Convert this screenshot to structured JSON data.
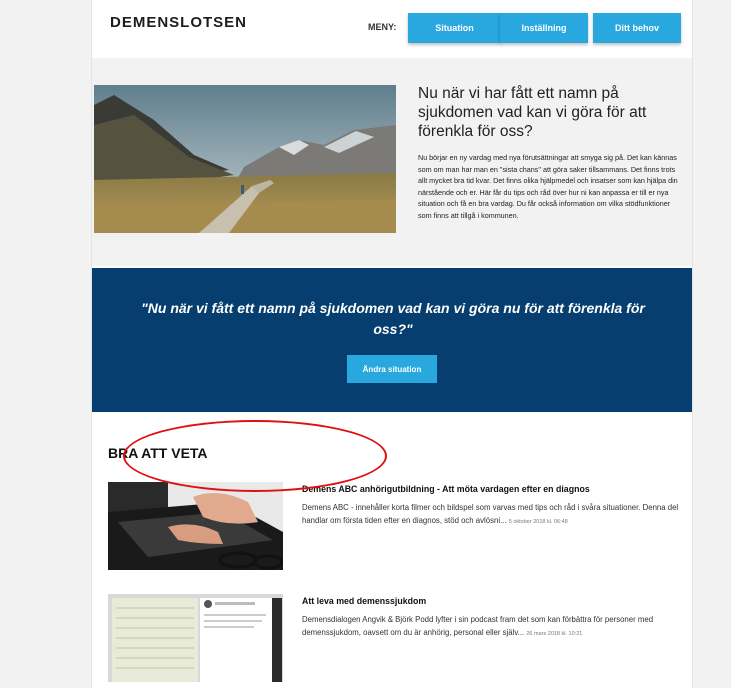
{
  "header": {
    "logo": "DEMENSLOTSEN",
    "menu_label": "MENY:",
    "nav": [
      "Situation",
      "Inställning",
      "Ditt behov"
    ]
  },
  "intro": {
    "title": "Nu när vi har fått ett namn på sjukdomen vad kan vi göra för att förenkla för oss?",
    "text": "Nu börjar en ny vardag med nya förutsättningar att smyga sig på. Det kan kännas som om man har man en \"sista chans\" att göra saker tillsammans. Det finns trots allt mycket bra tid kvar. Det finns olika hjälpmedel och insatser som kan hjälpa din närstående och er. Här får du tips och råd över hur ni kan anpassa er till er nya situation och få en bra vardag. Du får också information om vilka stödfunktioner som finns att tillgå i kommunen."
  },
  "banner": {
    "quote": "\"Nu när vi fått ett namn på sjukdomen vad kan vi göra nu för att förenkla för oss?\"",
    "button": "Ändra situation"
  },
  "section": {
    "title": "BRA ATT VETA"
  },
  "articles": [
    {
      "title": "Demens ABC anhörigutbildning - Att möta vardagen efter en diagnos",
      "text": "Demens ABC - innehåller korta filmer och bildspel som varvas med tips och råd i svåra situationer. Denna del handlar om första tiden efter en diagnos, stöd och avlösni...",
      "date": "5 oktober 2018 kl. 06:48"
    },
    {
      "title": "Att leva med demenssjukdom",
      "text": "Demensdialogen Angvik & Björk Podd lyfter i sin podcast fram det som kan förbättra för personer med demenssjukdom, oavsett om du är anhörig, personal eller själv...",
      "date": "26 mars 2018 kl. 10:21"
    }
  ],
  "colors": {
    "accent": "#29a7df",
    "banner": "#053e6f",
    "annotation": "#e01010"
  }
}
